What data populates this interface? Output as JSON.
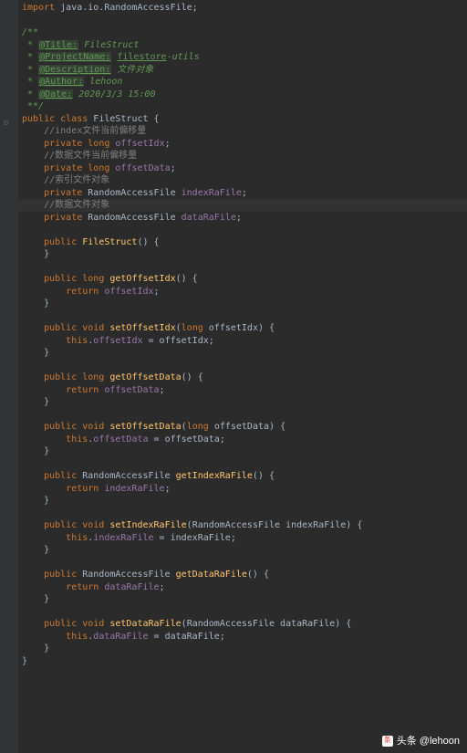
{
  "import_line": {
    "kw": "import",
    "pkg": "java.io.RandomAccessFile",
    "semi": ";"
  },
  "doc": {
    "open": "/**",
    "star": " * ",
    "title_tag": "@Title:",
    "title_val": "FileStruct",
    "proj_tag": "@ProjectName:",
    "proj_val": "filestore",
    "proj_suffix": "-utils",
    "desc_tag": "@Description:",
    "desc_val": "文件对象",
    "author_tag": "@Author:",
    "author_val": "lehoon",
    "date_tag": "@Date:",
    "date_val": "2020/3/3 15:00",
    "close": " **/"
  },
  "class": {
    "pub": "public",
    "cls": "class",
    "name": "FileStruct",
    "open": " {"
  },
  "fields": {
    "c1": "//index文件当前偏移量",
    "f1_priv": "private",
    "f1_type": "long",
    "f1_name": "offsetIdx",
    "c2": "//数据文件当前偏移量",
    "f2_priv": "private",
    "f2_type": "long",
    "f2_name": "offsetData",
    "c3": "//索引文件对象",
    "f3_priv": "private",
    "f3_type": "RandomAccessFile",
    "f3_name": "indexRaFile",
    "c4": "//数据文件对象",
    "f4_priv": "private",
    "f4_type": "RandomAccessFile",
    "f4_name": "dataRaFile"
  },
  "ctor": {
    "pub": "public",
    "name": "FileStruct",
    "sig": "() {",
    "close": "}"
  },
  "m1": {
    "pub": "public",
    "ret": "long",
    "name": "getOffsetIdx",
    "sig": "() {",
    "retkw": "return",
    "val": "offsetIdx",
    "close": "}"
  },
  "m2": {
    "pub": "public",
    "ret": "void",
    "name": "setOffsetIdx",
    "open": "(",
    "ptype": "long",
    "pname": "offsetIdx",
    "sig": ") {",
    "thiskw": "this",
    "dot": ".",
    "field": "offsetIdx",
    "eq": " = ",
    "arg": "offsetIdx",
    "close": "}"
  },
  "m3": {
    "pub": "public",
    "ret": "long",
    "name": "getOffsetData",
    "sig": "() {",
    "retkw": "return",
    "val": "offsetData",
    "close": "}"
  },
  "m4": {
    "pub": "public",
    "ret": "void",
    "name": "setOffsetData",
    "open": "(",
    "ptype": "long",
    "pname": "offsetData",
    "sig": ") {",
    "thiskw": "this",
    "dot": ".",
    "field": "offsetData",
    "eq": " = ",
    "arg": "offsetData",
    "close": "}"
  },
  "m5": {
    "pub": "public",
    "ret": "RandomAccessFile",
    "name": "getIndexRaFile",
    "sig": "() {",
    "retkw": "return",
    "val": "indexRaFile",
    "close": "}"
  },
  "m6": {
    "pub": "public",
    "ret": "void",
    "name": "setIndexRaFile",
    "open": "(",
    "ptype": "RandomAccessFile",
    "pname": "indexRaFile",
    "sig": ") {",
    "thiskw": "this",
    "dot": ".",
    "field": "indexRaFile",
    "eq": " = ",
    "arg": "indexRaFile",
    "close": "}"
  },
  "m7": {
    "pub": "public",
    "ret": "RandomAccessFile",
    "name": "getDataRaFile",
    "sig": "() {",
    "retkw": "return",
    "val": "dataRaFile",
    "close": "}"
  },
  "m8": {
    "pub": "public",
    "ret": "void",
    "name": "setDataRaFile",
    "open": "(",
    "ptype": "RandomAccessFile",
    "pname": "dataRaFile",
    "sig": ") {",
    "thiskw": "this",
    "dot": ".",
    "field": "dataRaFile",
    "eq": " = ",
    "arg": "dataRaFile",
    "close": "}"
  },
  "closebrace": "}",
  "semi": ";",
  "watermark": {
    "text": "头条 @lehoon"
  }
}
